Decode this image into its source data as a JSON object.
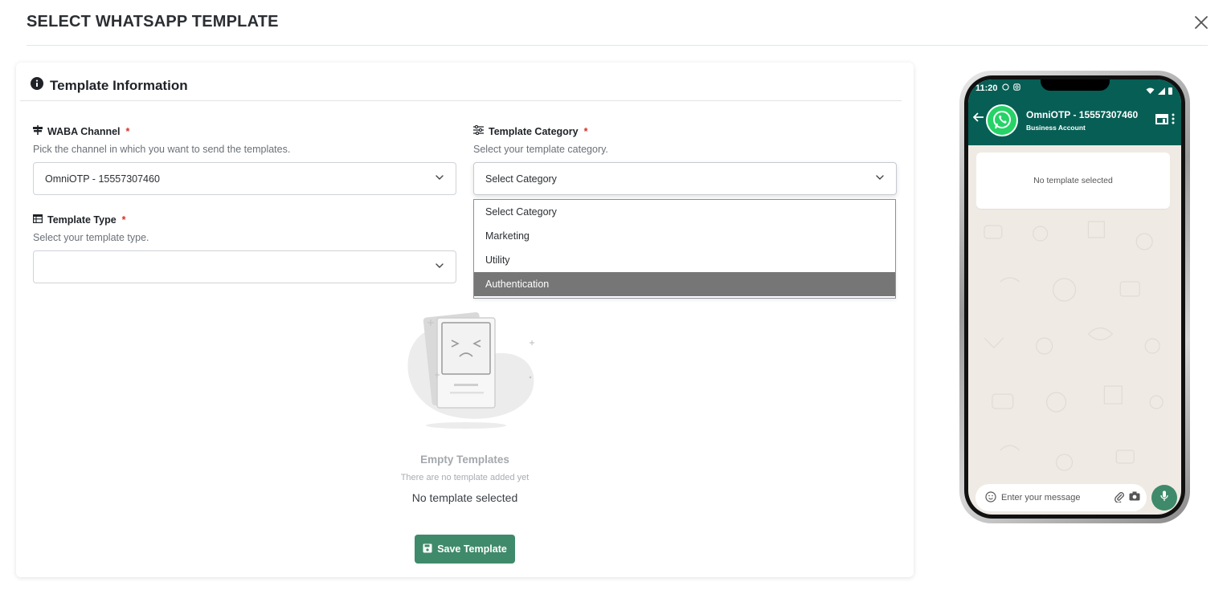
{
  "modal": {
    "title": "SELECT WHATSAPP TEMPLATE"
  },
  "card": {
    "title": "Template Information"
  },
  "waba_channel": {
    "label": "WABA Channel",
    "required_mark": "*",
    "help": "Pick the channel in which you want to send the templates.",
    "value": "OmniOTP - 15557307460"
  },
  "template_category": {
    "label": "Template Category",
    "required_mark": "*",
    "help": "Select your template category.",
    "value": "Select Category",
    "options": [
      "Select Category",
      "Marketing",
      "Utility",
      "Authentication"
    ],
    "highlighted_option": "Authentication"
  },
  "template_type": {
    "label": "Template Type",
    "required_mark": "*",
    "help": "Select your template type.",
    "value": ""
  },
  "empty_state": {
    "title": "Empty Templates",
    "subtitle": "There are no template added yet",
    "note": "No template selected"
  },
  "save_button": {
    "label": "Save Template"
  },
  "phone_preview": {
    "time": "11:20",
    "contact_name": "OmniOTP - 15557307460",
    "contact_status": "Business Account",
    "bubble_text": "No template selected",
    "input_placeholder": "Enter your message"
  },
  "colors": {
    "primary": "#3f8a6a",
    "whatsapp_header": "#075e54",
    "highlight": "#767676",
    "required": "#d93025"
  }
}
